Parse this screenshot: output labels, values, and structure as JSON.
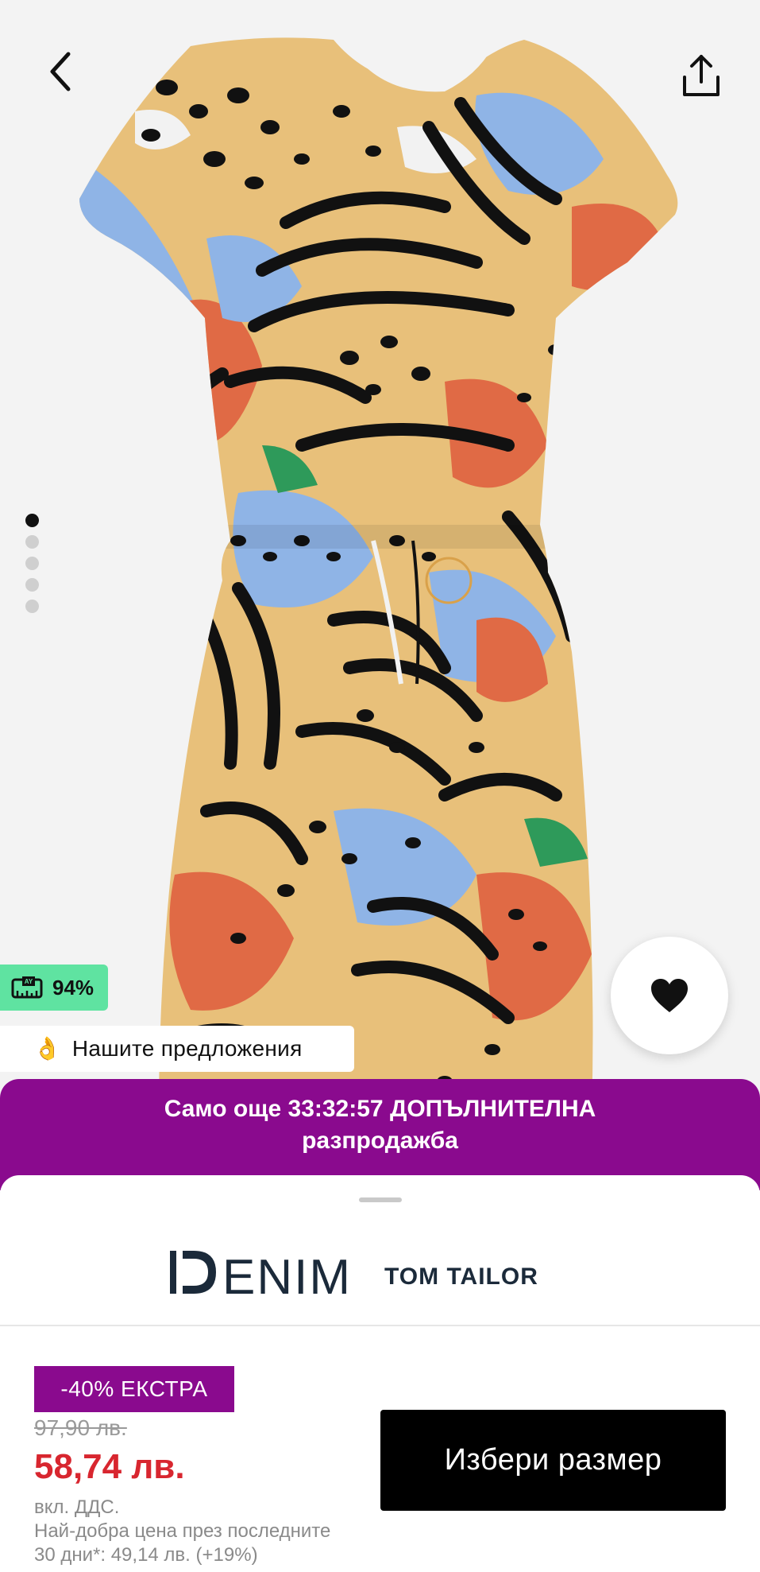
{
  "nav": {
    "back_icon": "chevron-left-icon",
    "share_icon": "share-upload-icon"
  },
  "gallery": {
    "total_images": 5,
    "active_index": 0
  },
  "fit_badge": {
    "icon": "ruler-fit-icon",
    "percent": "94%"
  },
  "offers": {
    "emoji": "👌",
    "label": "Нашите предложения"
  },
  "favorite": {
    "icon": "heart-icon"
  },
  "promo": {
    "line1": "Само още 33:32:57 ДОПЪЛНИТЕЛНА",
    "line2": "разпродажба",
    "color": "#8a0a8e"
  },
  "brand": {
    "name_part1": "DENIM",
    "name_part2": "TOM TAILOR"
  },
  "pricing": {
    "extra_badge": "-40% ЕКСТРА",
    "old_price": "97,90 лв.",
    "new_price": "58,74 лв.",
    "vat_note": "вкл. ДДС.",
    "best_price_line1": "Най-добра цена през последните",
    "best_price_line2": "30 дни*: 49,14 лв. (+19%)",
    "new_price_color": "#d8262f"
  },
  "cta": {
    "select_size": "Избери размер"
  }
}
